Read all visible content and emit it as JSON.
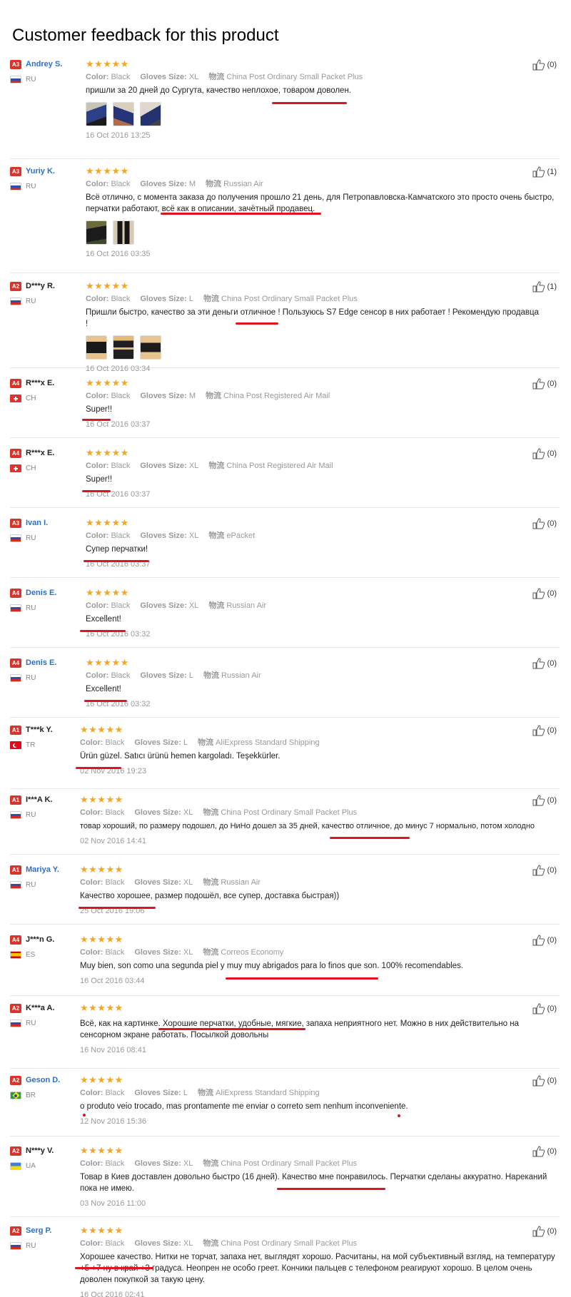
{
  "page": {
    "title": "Customer feedback for this product"
  },
  "labels": {
    "color": "Color:",
    "size": "Gloves Size:",
    "shipping": "物流"
  },
  "reviews": [
    {
      "level": "A3",
      "name": "Andrey S.",
      "country": "RU",
      "color": "Black",
      "size": "XL",
      "shipping": "China Post Ordinary Small Packet Plus",
      "text": "пришли за 20 дней до Сургута, качество неплохое, товаром доволен.",
      "date": "16 Oct 2016 13:25",
      "helpful": "(0)"
    },
    {
      "level": "A3",
      "name": "Yuriy K.",
      "country": "RU",
      "color": "Black",
      "size": "M",
      "shipping": "Russian Air",
      "text": "Всё отлично, с момента заказа до получения прошло 21 день, для Петропавловска-Камчатского это просто очень быстро, перчатки работают, всё как в описании, зачётный продавец.",
      "date": "16 Oct 2016 03:35",
      "helpful": "(1)"
    },
    {
      "level": "A2",
      "name": "D***y R.",
      "country": "RU",
      "color": "Black",
      "size": "L",
      "shipping": "China Post Ordinary Small Packet Plus",
      "text": "Пришли быстро, качество за эти деньги отличное ! Пользуюсь S7 Edge сенсор в них работает ! Рекомендую продавца !",
      "date": "16 Oct 2016 03:34",
      "helpful": "(1)"
    },
    {
      "level": "A4",
      "name": "R***x E.",
      "country": "CH",
      "color": "Black",
      "size": "M",
      "shipping": "China Post Registered Air Mail",
      "text": "Super!!",
      "date": "16 Oct 2016 03:37",
      "helpful": "(0)"
    },
    {
      "level": "A4",
      "name": "R***x E.",
      "country": "CH",
      "color": "Black",
      "size": "XL",
      "shipping": "China Post Registered Air Mail",
      "text": "Super!!",
      "date": "16 Oct 2016 03:37",
      "helpful": "(0)"
    },
    {
      "level": "A3",
      "name": "Ivan I.",
      "country": "RU",
      "color": "Black",
      "size": "XL",
      "shipping": "ePacket",
      "text": "Супер перчатки!",
      "date": "16 Oct 2016 03:37",
      "helpful": "(0)"
    },
    {
      "level": "A4",
      "name": "Denis E.",
      "country": "RU",
      "color": "Black",
      "size": "XL",
      "shipping": "Russian Air",
      "text": "Excellent!",
      "date": "16 Oct 2016 03:32",
      "helpful": "(0)"
    },
    {
      "level": "A4",
      "name": "Denis E.",
      "country": "RU",
      "color": "Black",
      "size": "L",
      "shipping": "Russian Air",
      "text": "Excellent!",
      "date": "16 Oct 2016 03:32",
      "helpful": "(0)"
    },
    {
      "level": "A1",
      "name": "T***k Y.",
      "country": "TR",
      "color": "Black",
      "size": "L",
      "shipping": "AliExpress Standard Shipping",
      "text": "Ürün güzel. Satıcı ürünü hemen kargoladı. Teşekkürler.",
      "date": "02 Nov 2016 19:23",
      "helpful": "(0)"
    },
    {
      "level": "A1",
      "name": "I***A K.",
      "country": "RU",
      "color": "Black",
      "size": "XL",
      "shipping": "China Post Ordinary Small Packet Plus",
      "text": "товар хороший, по размеру подошел, до НиНо дошел за 35 дней, качество отличное, до минус 7 нормально, потом холодно",
      "date": "02 Nov 2016 14:41",
      "helpful": "(0)"
    },
    {
      "level": "A1",
      "name": "Mariya Y.",
      "country": "RU",
      "color": "Black",
      "size": "XL",
      "shipping": "Russian Air",
      "text": "Качество хорошее, размер подошёл, все супер, доставка быстрая))",
      "date": "25 Oct 2016 19:06",
      "helpful": "(0)"
    },
    {
      "level": "A4",
      "name": "J***n G.",
      "country": "ES",
      "color": "Black",
      "size": "XL",
      "shipping": "Correos Economy",
      "text": "Muy bien, son como una segunda piel y muy muy abrigados para lo finos que son. 100% recomendables.",
      "date": "16 Oct 2016 03:44",
      "helpful": "(0)"
    },
    {
      "level": "A2",
      "name": "K***a A.",
      "country": "RU",
      "color": "",
      "size": "",
      "shipping": "",
      "text": "Всё, как на картинке. Хорошие перчатки, удобные, мягкие, запаха неприятного нет. Можно в них действительно на сенсорном экране работать. Посылкой довольны",
      "date": "16 Nov 2016 08:41",
      "helpful": "(0)"
    },
    {
      "level": "A2",
      "name": "Geson D.",
      "country": "BR",
      "color": "Black",
      "size": "L",
      "shipping": "AliExpress Standard Shipping",
      "text": "o produto veio trocado, mas prontamente me enviar o correto sem nenhum inconveniente.",
      "date": "12 Nov 2016 15:36",
      "helpful": "(0)"
    },
    {
      "level": "A2",
      "name": "N***y V.",
      "country": "UA",
      "color": "Black",
      "size": "XL",
      "shipping": "China Post Ordinary Small Packet Plus",
      "text": "Товар в Киев доставлен довольно быстро (16 дней). Качество мне понравилось. Перчатки сделаны аккуратно. Нареканий пока не имею.",
      "date": "03 Nov 2016 11:00",
      "helpful": "(0)"
    },
    {
      "level": "A2",
      "name": "Serg P.",
      "country": "RU",
      "color": "Black",
      "size": "XL",
      "shipping": "China Post Ordinary Small Packet Plus",
      "text": "Хорошее качество. Нитки не торчат, запаха нет, выглядят хорошо. Расчитаны, на мой субъективный взгляд, на температуру +5 +7 ну в край +3 градуса. Неопрен не особо греет. Кончики пальцев с телефоном реагируют хорошо. В целом очень доволен покупкой за такую цену.",
      "date": "16 Oct 2016 02:41",
      "helpful": "(0)"
    }
  ]
}
